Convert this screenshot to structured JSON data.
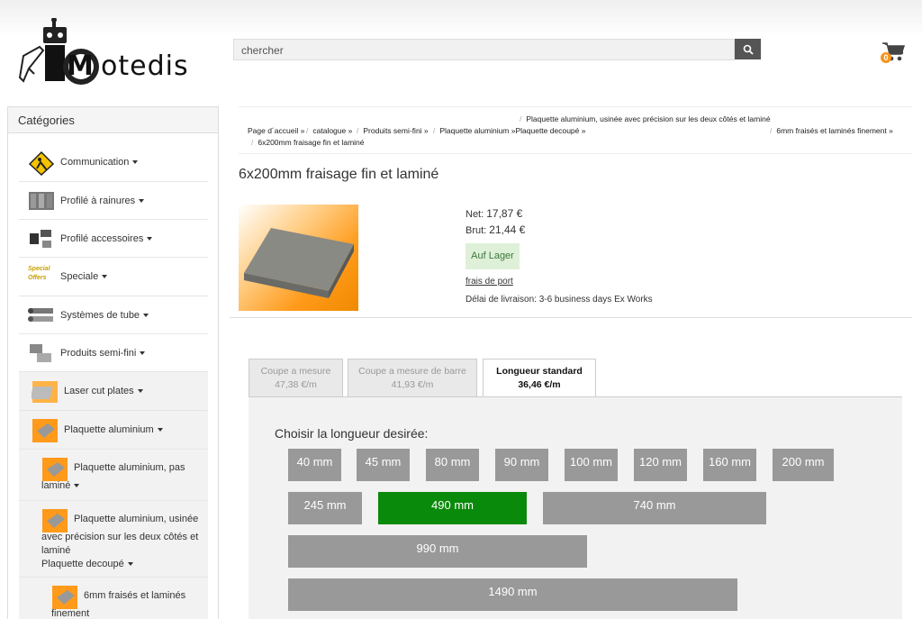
{
  "header": {
    "logo_text": "Motedis",
    "search_placeholder": "chercher",
    "cart_count": "0"
  },
  "sidebar": {
    "title": "Catégories",
    "items": [
      {
        "label": "Communication",
        "icon": "warning-sign-icon"
      },
      {
        "label": "Profilé à rainures",
        "icon": "profile-icon"
      },
      {
        "label": "Profilé accessoires",
        "icon": "accessories-icon"
      },
      {
        "label": "Speciale",
        "icon": "special-offers-icon"
      },
      {
        "label": "Systèmes de tube",
        "icon": "tube-icon"
      },
      {
        "label": "Produits semi-fini",
        "icon": "semi-finished-icon"
      },
      {
        "label": "Laser cut plates",
        "icon": "laser-plate-icon"
      },
      {
        "label": "Plaquette aluminium",
        "icon": "aluminium-plate-icon"
      },
      {
        "label_line1": "Plaquette aluminium, pas",
        "label_line2": "laminé",
        "icon": "aluminium-plate-icon"
      },
      {
        "label_line1": "Plaquette aluminium, usinée",
        "label_line2": "avec précision sur les deux côtés et",
        "label_line3": "laminé",
        "label_line4": "Plaquette decoupé",
        "icon": "aluminium-plate-icon"
      },
      {
        "label_line1": "6mm fraisés et laminés",
        "label_line2": "finement",
        "icon": "aluminium-plate-icon"
      }
    ],
    "special_text_1": "Special",
    "special_text_2": "Offers"
  },
  "breadcrumb": {
    "home": "Page d´accueil »",
    "catalogue": "catalogue »",
    "semi": "Produits semi-fini »",
    "plaquette": "Plaquette aluminium »Plaquette decoupé »",
    "precision": "Plaquette aluminium, usinée avec précision sur les deux côtés et laminé",
    "sixmm": "6mm fraisés et laminés finement »",
    "current": "6x200mm fraisage fin et laminé"
  },
  "product": {
    "title": "6x200mm fraisage fin et laminé",
    "net_label": "Net:",
    "net_value": "17,87 €",
    "brut_label": "Brut:",
    "brut_value": "21,44 €",
    "stock": "Auf Lager",
    "shipping": "frais de port",
    "delivery": "Délai de livraison: 3-6 business days Ex Works"
  },
  "tabs": [
    {
      "label": "Coupe a mesure",
      "price": "47,38 €/m"
    },
    {
      "label": "Coupe a mesure de barre",
      "price": "41,93 €/m"
    },
    {
      "label": "Longueur standard",
      "price": "36,46 €/m"
    }
  ],
  "lengths": {
    "title": "Choisir la longueur desirée:",
    "options": [
      "40 mm",
      "45 mm",
      "80 mm",
      "90 mm",
      "100 mm",
      "120 mm",
      "160 mm",
      "200 mm",
      "245 mm",
      "490 mm",
      "740 mm",
      "990 mm",
      "1490 mm"
    ],
    "selected": "490 mm"
  },
  "colors": {
    "selected_green": "#0a8a0a",
    "option_grey": "#999999",
    "stock_bg": "#dff0d8",
    "cart_badge": "#f7941d"
  }
}
